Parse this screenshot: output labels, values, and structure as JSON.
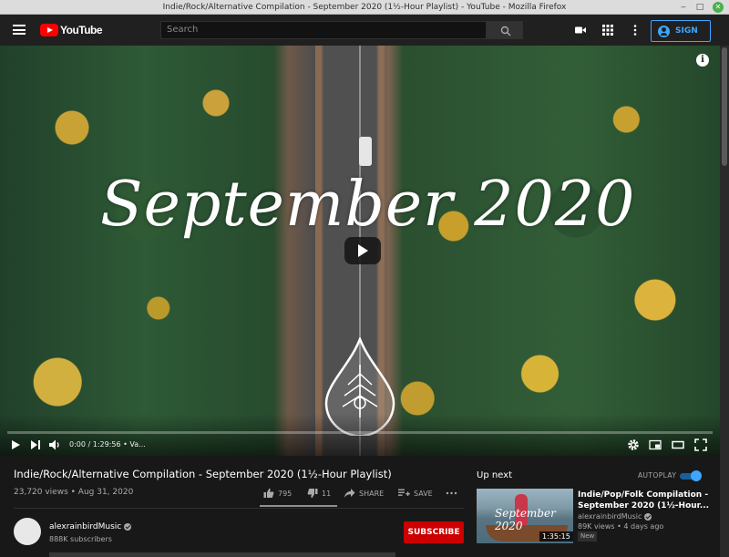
{
  "window": {
    "title": "Indie/Rock/Alternative Compilation - September 2020 (1½-Hour Playlist) - YouTube - Mozilla Firefox"
  },
  "masthead": {
    "logo_text": "YouTube",
    "search_placeholder": "Search",
    "signin_label": "SIGN IN",
    "icons": [
      "menu-icon",
      "search-icon",
      "camera-icon",
      "apps-icon",
      "more-vert-icon",
      "account-icon"
    ]
  },
  "player": {
    "overlay_title": "September 2020",
    "time_display": "0:00 / 1:29:56 • Va...",
    "progress": 0,
    "colors": {
      "progress_track": "#ffffff4d",
      "play_badge": "#141414"
    },
    "icons": [
      "info-icon",
      "play-icon",
      "next-icon",
      "volume-icon",
      "settings-icon",
      "miniplayer-icon",
      "theater-icon",
      "fullscreen-icon"
    ]
  },
  "video": {
    "title": "Indie/Rock/Alternative Compilation - September 2020 (1½-Hour Playlist)",
    "meta": "23,720 views • Aug 31, 2020",
    "likes": "795",
    "dislikes": "11",
    "share_label": "SHARE",
    "save_label": "SAVE"
  },
  "channel": {
    "name": "alexrainbirdMusic",
    "subscribers": "888K subscribers",
    "subscribe_label": "SUBSCRIBE",
    "subscribe_color": "#cc0000"
  },
  "sidebar": {
    "heading": "Up next",
    "autoplay_label": "AUTOPLAY",
    "autoplay_on": true,
    "accent": "#3ea6ff",
    "items": [
      {
        "title": "Indie/Pop/Folk Compilation - September 2020 (1½-Hour...",
        "channel": "alexrainbirdMusic",
        "meta": "89K views • 4 days ago",
        "badge": "New",
        "duration": "1:35:15",
        "thumb_text": "September 2020"
      }
    ]
  }
}
